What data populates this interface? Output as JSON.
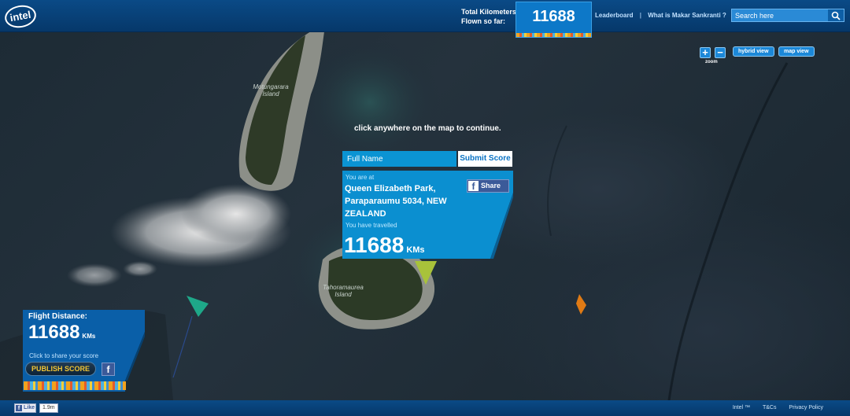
{
  "header": {
    "km_caption_line1": "Total Kilometers",
    "km_caption_line2": "Flown so far:",
    "km_total": "11688",
    "leaderboard_link": "Leaderboard",
    "separator": "|",
    "about_link": "What is Makar Sankranti ?",
    "search_placeholder": "Search here",
    "logo_text": "intel"
  },
  "map_controls": {
    "zoom_in": "+",
    "zoom_out": "−",
    "zoom_label": "zoom",
    "hybrid_view": "hybrid view",
    "map_view": "map view"
  },
  "map": {
    "island_1": "Motungarara Island",
    "island_2": "Tahoramaurea Island",
    "continue_message": "click anywhere on the map to continue."
  },
  "score_popup": {
    "name_placeholder": "Full Name",
    "submit_label": "Submit Score",
    "you_are_at": "You are at",
    "location": "Queen Elizabeth Park, Paraparaumu 5034,  NEW ZEALAND",
    "share_label": "Share",
    "you_travelled": "You have travelled",
    "distance": "11688",
    "unit": "KMs"
  },
  "flight_card": {
    "title": "Flight Distance:",
    "distance": "11688",
    "unit": "KMs",
    "share_hint": "Click to share your score",
    "publish_label": "PUBLISH SCORE"
  },
  "footer": {
    "like_label": "Like",
    "like_count": "1.9m",
    "links": [
      "Intel ™",
      "T&Cs",
      "Privacy Policy"
    ]
  },
  "colors": {
    "header_blue": "#06386a",
    "panel_blue": "#0b8fd0",
    "accent_yellow": "#f2c535"
  }
}
